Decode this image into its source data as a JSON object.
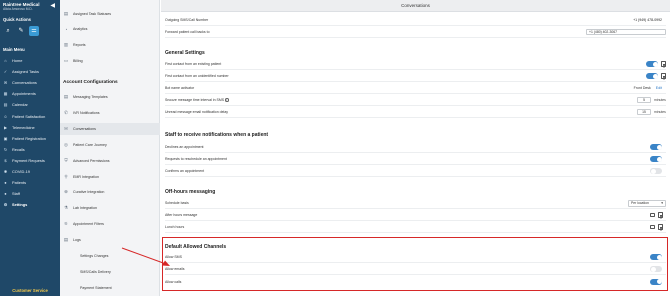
{
  "brand": {
    "name": "Raintree Medical",
    "sub": "Alicia Amoroso M.D."
  },
  "quick_actions": {
    "label": "Quick Actions"
  },
  "main_menu": {
    "label": "Main Menu",
    "items": [
      {
        "label": "Home",
        "icon": "home-icon",
        "glyph": "⌂"
      },
      {
        "label": "Assigned Tasks",
        "icon": "tasks-icon",
        "glyph": "✓"
      },
      {
        "label": "Conversations",
        "icon": "chat-icon",
        "glyph": "✉"
      },
      {
        "label": "Appointments",
        "icon": "calendar-icon",
        "glyph": "▦"
      },
      {
        "label": "Calendar",
        "icon": "calendar-icon",
        "glyph": "▤"
      },
      {
        "label": "Patient Satisfaction",
        "icon": "smile-icon",
        "glyph": "☺"
      },
      {
        "label": "Telemedicine",
        "icon": "video-icon",
        "glyph": "▶"
      },
      {
        "label": "Patient Registration",
        "icon": "clipboard-icon",
        "glyph": "▣"
      },
      {
        "label": "Recalls",
        "icon": "recall-icon",
        "glyph": "↻"
      },
      {
        "label": "Payment Requests",
        "icon": "payment-icon",
        "glyph": "$"
      },
      {
        "label": "COVID-19",
        "icon": "virus-icon",
        "glyph": "✱"
      },
      {
        "label": "Patients",
        "icon": "patients-icon",
        "glyph": "●"
      },
      {
        "label": "Staff",
        "icon": "staff-icon",
        "glyph": "●"
      },
      {
        "label": "Settings",
        "icon": "gear-icon",
        "glyph": "⚙"
      }
    ]
  },
  "customer_service": "Customer Service",
  "panel": {
    "top_items": [
      {
        "label": "Assigned Task Statuses",
        "glyph": "▤"
      },
      {
        "label": "Analytics",
        "glyph": "◔"
      },
      {
        "label": "Reports",
        "glyph": "▥"
      },
      {
        "label": "Billing",
        "glyph": "▭"
      }
    ],
    "heading": "Account Configurations",
    "config_items": [
      {
        "label": "Messaging Templates",
        "glyph": "▤"
      },
      {
        "label": "IVR Notifications",
        "glyph": "✆"
      },
      {
        "label": "Conversations",
        "glyph": "✉"
      },
      {
        "label": "Patient Care Journey",
        "glyph": "◎"
      },
      {
        "label": "Advanced Permissions",
        "glyph": "⛨"
      },
      {
        "label": "EMR Integration",
        "glyph": "⚲"
      },
      {
        "label": "Curative Integration",
        "glyph": "⊕"
      },
      {
        "label": "Lab Integration",
        "glyph": "⚗"
      },
      {
        "label": "Appointment Filters",
        "glyph": "⚟"
      },
      {
        "label": "Logs",
        "glyph": "▤"
      }
    ],
    "sub_items": [
      "Settings Changes",
      "SMS/Calls Delivery",
      "Payment Statement"
    ]
  },
  "main": {
    "title": "Conversations",
    "outgoing": {
      "label": "Outgoing SMS/Call Number",
      "value": "+1 (949) 478-0992"
    },
    "forward": {
      "label": "Forward patient call backs to",
      "value": "+1 (480) 402-3067"
    },
    "general": {
      "heading": "General Settings",
      "first_existing": "First contact from an existing patient",
      "first_unidentified": "First contact from an unidentified number",
      "bot_activator": {
        "label": "Bot name activator",
        "value": "Front Desk",
        "edit": "Edit"
      },
      "snooze": {
        "label": "Snooze message time interval in SMS",
        "value": "5",
        "unit": "minutes"
      },
      "unread": {
        "label": "Unread message email notification delay",
        "value": "15",
        "unit": "minutes"
      }
    },
    "staff": {
      "heading": "Staff to receive notifications when a patient",
      "declines": "Declines an appointment",
      "reschedule": "Requests to reschedule an appointment",
      "confirms": "Confirms an appointment"
    },
    "offhours": {
      "heading": "Off-hours messaging",
      "schedule": {
        "label": "Schedule basis",
        "value": "Per location"
      },
      "after_hours": "After hours message",
      "lunch": "Lunch hours"
    },
    "channels": {
      "heading": "Default Allowed Channels",
      "sms": "Allow SMS",
      "emails": "Allow emails",
      "calls": "Allow calls"
    }
  },
  "colors": {
    "sidebar": "#1f4868",
    "accent": "#3a84c7",
    "highlight": "#d62828",
    "customer_service": "#f2c84b"
  }
}
